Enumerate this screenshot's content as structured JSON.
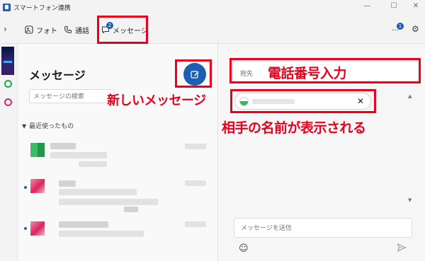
{
  "window": {
    "title": "スマートフォン連携",
    "controls": {
      "minimize": "—",
      "maximize": "☐",
      "close": "✕"
    }
  },
  "toolbar": {
    "back_glyph": "›",
    "tabs": [
      {
        "label": "フォト",
        "icon": "photo-icon"
      },
      {
        "label": "通話",
        "icon": "phone-icon"
      },
      {
        "label": "メッセージ",
        "icon": "message-icon",
        "badge": "2",
        "active": true
      }
    ],
    "notifications_badge": "1",
    "notifications_glyph": "…",
    "settings_glyph": "⚙"
  },
  "rail": {
    "items": [
      {
        "icon": "phone-wallpaper-thumbnail"
      },
      {
        "icon": "green-ring-icon",
        "color": "#1fa84f"
      },
      {
        "icon": "pink-ring-icon",
        "color": "#d12a6b"
      }
    ]
  },
  "messages_pane": {
    "title": "メッセージ",
    "search_placeholder": "メッセージの検索",
    "recent_label": "最近使ったもの",
    "recent_caret": "▼",
    "compose_icon": "compose-icon",
    "conversations": [
      {
        "unread": false,
        "avatar_color": "#2ebd5f"
      },
      {
        "unread": true,
        "avatar_color": "#d9255e"
      },
      {
        "unread": true,
        "avatar_color": "#d9255e"
      }
    ]
  },
  "compose_pane": {
    "to_label": "宛先",
    "recipient_chip_close": "✕",
    "message_placeholder": "メッセージを送信",
    "emoji_glyph": "☺",
    "scroll_up": "▲",
    "scroll_down": "▼"
  },
  "annotations": {
    "new_message": "新しいメッセージ",
    "enter_phone": "電話番号入力",
    "name_shown": "相手の名前が表示される",
    "highlight_color": "#e8001c"
  }
}
